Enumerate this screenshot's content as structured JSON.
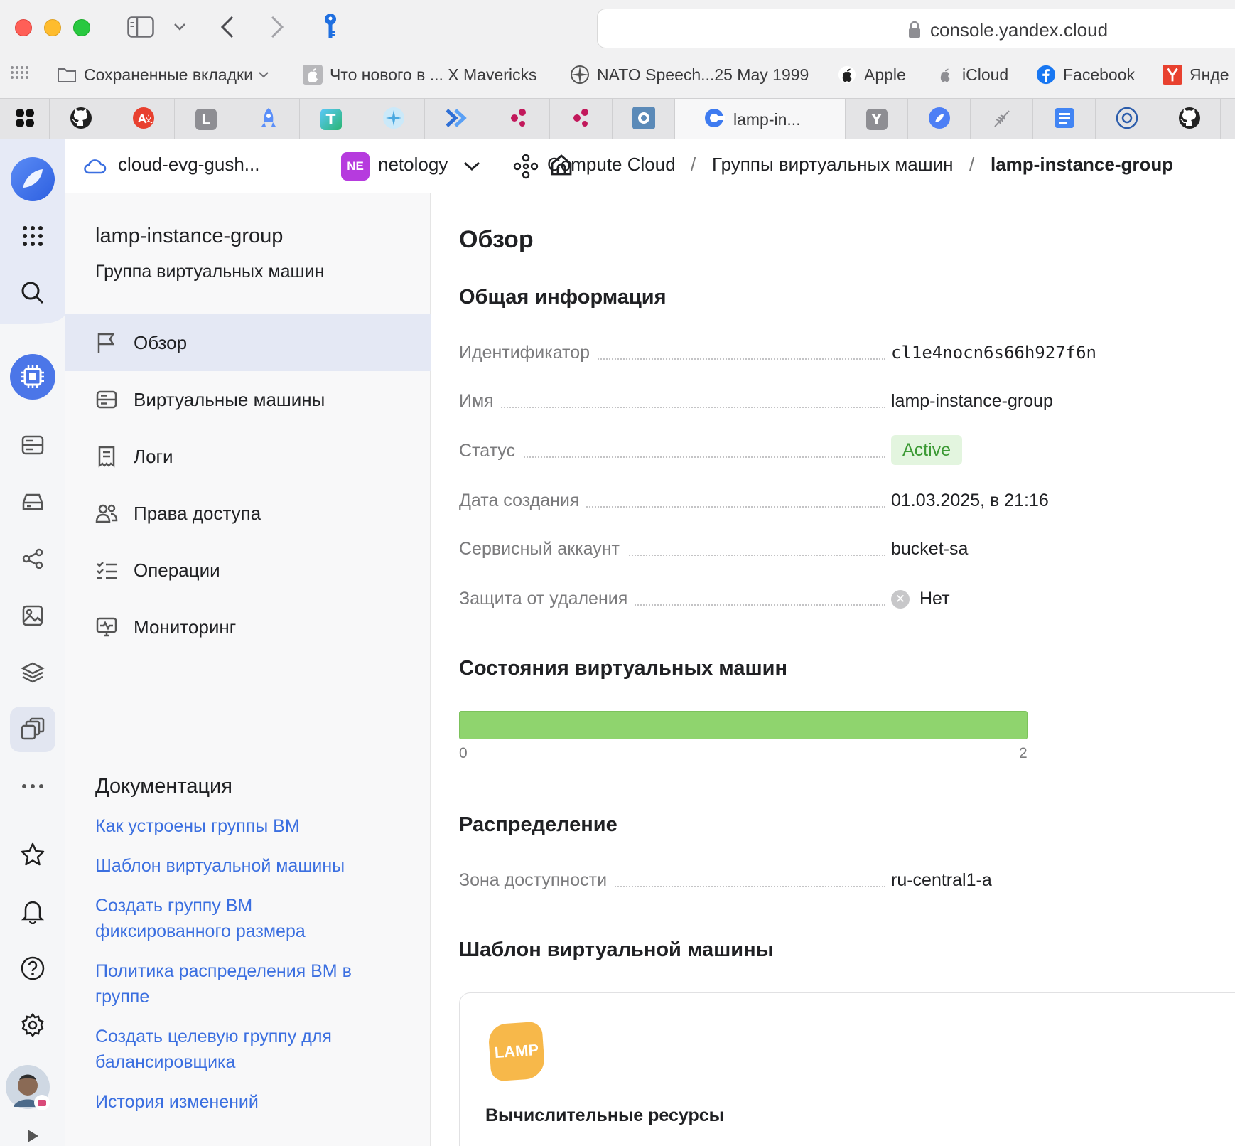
{
  "browser": {
    "url": "console.yandex.cloud",
    "bookmarks": [
      {
        "label": "Сохраненные вкладки",
        "icon": "folder-icon"
      },
      {
        "label": "Что нового в ... X Mavericks",
        "icon": "apple-icon"
      },
      {
        "label": "NATO Speech...25 May 1999",
        "icon": "compass-icon"
      },
      {
        "label": "Apple",
        "icon": "apple-icon"
      },
      {
        "label": "iCloud",
        "icon": "apple-icon"
      },
      {
        "label": "Facebook",
        "icon": "facebook-icon"
      },
      {
        "label": "Янде",
        "icon": "yandex-icon"
      }
    ],
    "active_tab_title": "lamp-in...",
    "tab_letters": {
      "l": "L",
      "t": "T",
      "y": "Y"
    }
  },
  "header": {
    "cloud": "cloud-evg-gush...",
    "folder_badge": "NE",
    "folder": "netology",
    "breadcrumbs": [
      "Compute Cloud",
      "Группы виртуальных машин",
      "lamp-instance-group"
    ],
    "separator": "/"
  },
  "subnav": {
    "title": "lamp-instance-group",
    "subtitle": "Группа виртуальных машин",
    "items": [
      {
        "label": "Обзор",
        "icon": "flag-icon"
      },
      {
        "label": "Виртуальные машины",
        "icon": "server-icon"
      },
      {
        "label": "Логи",
        "icon": "log-icon"
      },
      {
        "label": "Права доступа",
        "icon": "users-icon"
      },
      {
        "label": "Операции",
        "icon": "checklist-icon"
      },
      {
        "label": "Мониторинг",
        "icon": "monitor-icon"
      }
    ],
    "docs_title": "Документация",
    "docs": [
      "Как устроены группы ВМ",
      "Шаблон виртуальной машины",
      "Создать группу ВМ фиксированного размера",
      "Политика распределения ВМ в группе",
      "Создать целевую группу для балансировщика",
      "История изменений"
    ]
  },
  "main": {
    "title": "Обзор",
    "general_title": "Общая информация",
    "fields": {
      "id_label": "Идентификатор",
      "id_value": "cl1e4nocn6s66h927f6n",
      "name_label": "Имя",
      "name_value": "lamp-instance-group",
      "status_label": "Статус",
      "status_value": "Active",
      "created_label": "Дата создания",
      "created_value": "01.03.2025, в 21:16",
      "sa_label": "Сервисный аккаунт",
      "sa_value": "bucket-sa",
      "protect_label": "Защита от удаления",
      "protect_value": "Нет"
    },
    "states_title": "Состояния виртуальных машин",
    "states": {
      "min": "0",
      "max": "2",
      "running_fraction": 1.0
    },
    "distribution_title": "Распределение",
    "zone_label": "Зона доступности",
    "zone_value": "ru-central1-a",
    "template_title": "Шаблон виртуальной машины",
    "template_logo": "LAMP",
    "template_sub": "Вычислительные ресурсы"
  },
  "colors": {
    "accent": "#3b6fe0",
    "status_bg": "#e3f5df",
    "status_fg": "#3c9a35",
    "bar": "#8fd46e",
    "ne_badge": "#b63bde"
  }
}
